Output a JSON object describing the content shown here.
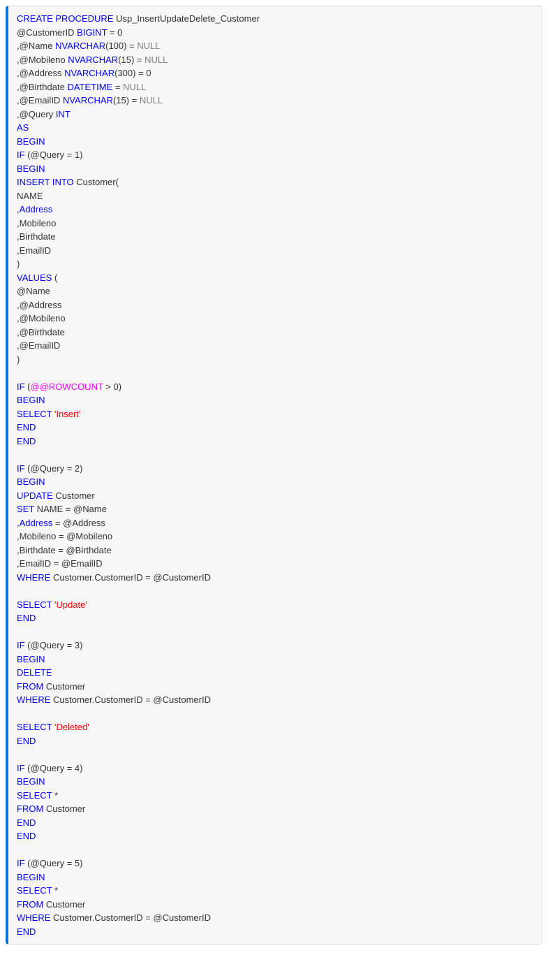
{
  "code": {
    "t1_a": "CREATE",
    "t1_b": "PROCEDURE",
    "t1_c": " Usp_InsertUpdateDelete_Customer",
    "t2_a": "@CustomerID ",
    "t2_b": "BIGINT",
    "t2_c": " = 0",
    "t3_a": ",@Name ",
    "t3_b": "NVARCHAR",
    "t3_c": "(100) = ",
    "t3_d": "NULL",
    "t4_a": ",@Mobileno ",
    "t4_b": "NVARCHAR",
    "t4_c": "(15) = ",
    "t4_d": "NULL",
    "t5_a": ",@Address ",
    "t5_b": "NVARCHAR",
    "t5_c": "(300) = 0",
    "t6_a": ",@Birthdate ",
    "t6_b": "DATETIME",
    "t6_c": " = ",
    "t6_d": "NULL",
    "t7_a": ",@EmailID ",
    "t7_b": "NVARCHAR",
    "t7_c": "(15) = ",
    "t7_d": "NULL",
    "t8_a": ",@Query ",
    "t8_b": "INT",
    "t9": "AS",
    "t10": "BEGIN",
    "t11_a": "IF",
    "t11_b": " (@Query = 1)",
    "t12": "BEGIN",
    "t13_a": "INSERT",
    "t13_b": "INTO",
    "t13_c": " Customer(",
    "t14": "NAME",
    "t15_a": ",",
    "t15_b": "Address",
    "t16": ",Mobileno",
    "t17": ",Birthdate",
    "t18": ",EmailID",
    "t19": ")",
    "t20_a": "VALUES",
    "t20_b": " (",
    "t21": "@Name",
    "t22": ",@Address",
    "t23": ",@Mobileno",
    "t24": ",@Birthdate",
    "t25": ",@EmailID",
    "t26": ")",
    "t27": "",
    "t28_a": "IF",
    "t28_b": " (",
    "t28_c": "@@ROWCOUNT",
    "t28_d": " > 0)",
    "t29": "BEGIN",
    "t30_a": "SELECT",
    "t30_b": " ",
    "t30_c": "'Insert'",
    "t31": "END",
    "t32": "END",
    "t33": "",
    "t34_a": "IF",
    "t34_b": " (@Query = 2)",
    "t35": "BEGIN",
    "t36_a": "UPDATE",
    "t36_b": " Customer",
    "t37_a": "SET",
    "t37_b": " NAME = @Name",
    "t38_a": ",",
    "t38_b": "Address",
    "t38_c": " = @Address",
    "t39": ",Mobileno = @Mobileno",
    "t40": ",Birthdate = @Birthdate",
    "t41": ",EmailID = @EmailID",
    "t42_a": "WHERE",
    "t42_b": " Customer.CustomerID = @CustomerID",
    "t43": "",
    "t44_a": "SELECT",
    "t44_b": " ",
    "t44_c": "'Update'",
    "t45": "END",
    "t46": "",
    "t47_a": "IF",
    "t47_b": " (@Query = 3)",
    "t48": "BEGIN",
    "t49": "DELETE",
    "t50_a": "FROM",
    "t50_b": " Customer",
    "t51_a": "WHERE",
    "t51_b": " Customer.CustomerID = @CustomerID",
    "t52": "",
    "t53_a": "SELECT",
    "t53_b": " ",
    "t53_c": "'Deleted'",
    "t54": "END",
    "t55": "",
    "t56_a": "IF",
    "t56_b": " (@Query = 4)",
    "t57": "BEGIN",
    "t58_a": "SELECT",
    "t58_b": " *",
    "t59_a": "FROM",
    "t59_b": " Customer",
    "t60": "END",
    "t61": "END",
    "t62": "",
    "t63_a": "IF",
    "t63_b": " (@Query = 5)",
    "t64": "BEGIN",
    "t65_a": "SELECT",
    "t65_b": " *",
    "t66_a": "FROM",
    "t66_b": " Customer",
    "t67_a": "WHERE",
    "t67_b": " Customer.CustomerID = @CustomerID",
    "t68": "END"
  }
}
